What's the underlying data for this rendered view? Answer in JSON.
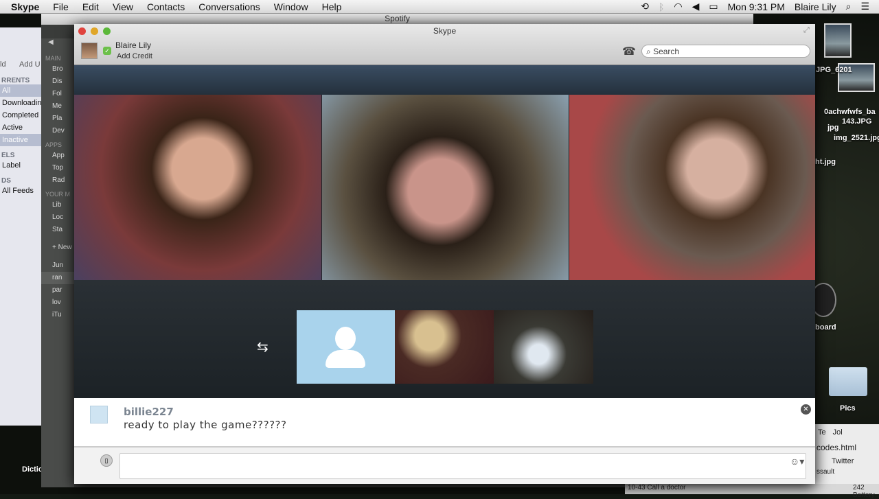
{
  "menubar": {
    "app": "Skype",
    "items": [
      "File",
      "Edit",
      "View",
      "Contacts",
      "Conversations",
      "Window",
      "Help"
    ],
    "clock": "Mon 9:31 PM",
    "user": "Blaire Lily",
    "icons": [
      "time-machine-icon",
      "bluetooth-icon",
      "wifi-icon",
      "volume-icon",
      "battery-icon",
      "spotlight-icon",
      "notification-list-icon"
    ]
  },
  "torrent": {
    "toolbar": [
      "ld",
      "Add U"
    ],
    "sections": [
      {
        "title": "RRENTS",
        "items": [
          "All",
          "Downloadin",
          "Completed",
          "Active",
          "Inactive"
        ]
      },
      {
        "title": "ELS",
        "items": [
          "Label"
        ]
      },
      {
        "title": "DS",
        "items": [
          "All Feeds"
        ]
      }
    ]
  },
  "spotify": {
    "title": "Spotify",
    "sections": [
      {
        "title": "MAIN",
        "items": [
          "Bro",
          "Dis",
          "Fol",
          "Me",
          "Pla",
          "Dev"
        ]
      },
      {
        "title": "APPS",
        "items": [
          "App",
          "Top",
          "Rad"
        ]
      },
      {
        "title": "YOUR M",
        "items": [
          "Lib",
          "Loc",
          "Sta"
        ]
      }
    ],
    "new_playlist": "+ New",
    "playlists": [
      "Jun",
      "ran",
      "par",
      "lov",
      "iTu"
    ]
  },
  "skype": {
    "title": "Skype",
    "user": "Blaire Lily",
    "add_credit": "Add Credit",
    "search_placeholder": "Search",
    "chat": {
      "user": "billie227",
      "message": "ready to play the game??????"
    }
  },
  "desktop": {
    "files": [
      "JPG_6201",
      "0achwfwfs_ba",
      "143.JPG",
      "img_2521.jpg",
      "jpg",
      "ht.jpg"
    ],
    "dashboard": "board",
    "folder": "Pics",
    "dict": "Dictio"
  },
  "browser": {
    "tabs": [
      "Te",
      "Jol"
    ],
    "file": "codes.html",
    "twitter": "Twitter",
    "items": [
      "10-43 Call a doctor",
      "ssault",
      "242 Battery"
    ]
  }
}
